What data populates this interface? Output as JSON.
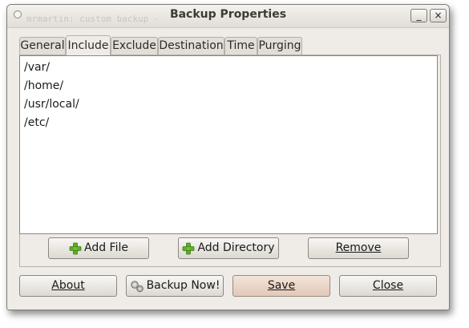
{
  "window": {
    "title": "Backup Properties",
    "ghost_title": "mrmartin: custom backup -",
    "minimize_glyph": "_",
    "close_glyph": "×"
  },
  "tabs": [
    {
      "label": "General"
    },
    {
      "label": "Include",
      "active": true
    },
    {
      "label": "Exclude"
    },
    {
      "label": "Destination"
    },
    {
      "label": "Time"
    },
    {
      "label": "Purging"
    }
  ],
  "include_list": [
    "/var/",
    "/home/",
    "/usr/local/",
    "/etc/"
  ],
  "list_buttons": {
    "add_file": {
      "label": "Add File",
      "icon": "plus-icon"
    },
    "add_directory": {
      "label": "Add Directory",
      "icon": "plus-icon"
    },
    "remove": {
      "label": "Remove"
    }
  },
  "bottom_buttons": {
    "about": {
      "label": "About"
    },
    "backup_now": {
      "label": "Backup Now!",
      "icon": "gears-icon"
    },
    "save": {
      "label": "Save"
    },
    "close": {
      "label": "Close"
    }
  },
  "colors": {
    "plus_green": "#5fae2a",
    "save_tint": "#e7cfc0"
  }
}
